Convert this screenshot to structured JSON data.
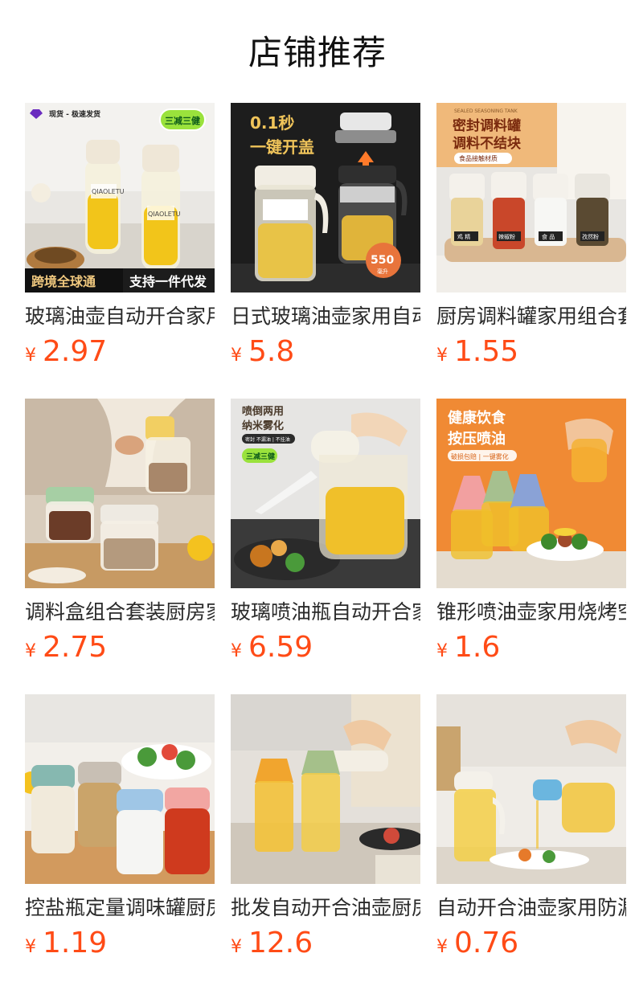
{
  "header": {
    "title": "店铺推荐"
  },
  "colors": {
    "price": "#ff4b16",
    "title_text": "#2a2a2a"
  },
  "products": [
    {
      "title": "玻璃油壶自动开合家用防漏厨房",
      "currency": "¥",
      "price": "2.97",
      "image_text": {
        "top_left": "现货 - 极速发货",
        "badge": "三减三健",
        "brand1": "QIAOLETU",
        "brand2": "QIAOLETU",
        "banner_left": "跨境全球通",
        "banner_right": "支持一件代发"
      }
    },
    {
      "title": "日式玻璃油壶家用自动开合防漏",
      "currency": "¥",
      "price": "5.8",
      "image_text": {
        "headline1": "0.1秒",
        "headline2": "一键开盖",
        "capacity": "550",
        "capacity_unit": "毫升"
      }
    },
    {
      "title": "厨房调料罐家用组合套装",
      "currency": "¥",
      "price": "1.55",
      "image_text": {
        "top_small": "SEALED SEASONING TANK",
        "headline1": "密封调料罐",
        "headline2": "调料不结块",
        "tag": "食品接触材质",
        "label1": "鸡 精",
        "label2": "辣椒粉",
        "label3": "食 品",
        "label4": "孜然粉"
      }
    },
    {
      "title": "调料盒组合套装厨房家用",
      "currency": "¥",
      "price": "2.75",
      "image_text": {}
    },
    {
      "title": "玻璃喷油瓶自动开合家用",
      "currency": "¥",
      "price": "6.59",
      "image_text": {
        "headline1": "喷倒两用",
        "headline2": "纳米雾化",
        "tag": "密封 不漏油 | 不挂油",
        "badge": "三减三健"
      }
    },
    {
      "title": "锥形喷油壶家用烧烤空气炸锅",
      "currency": "¥",
      "price": "1.6",
      "image_text": {
        "headline1": "健康饮食",
        "headline2": "按压喷油",
        "tag": "破损包赔 | 一键雾化"
      }
    },
    {
      "title": "控盐瓶定量调味罐厨房家用",
      "currency": "¥",
      "price": "1.19",
      "image_text": {}
    },
    {
      "title": "批发自动开合油壶厨房家用",
      "currency": "¥",
      "price": "12.6",
      "image_text": {}
    },
    {
      "title": "自动开合油壶家用防漏玻璃",
      "currency": "¥",
      "price": "0.76",
      "image_text": {}
    }
  ]
}
